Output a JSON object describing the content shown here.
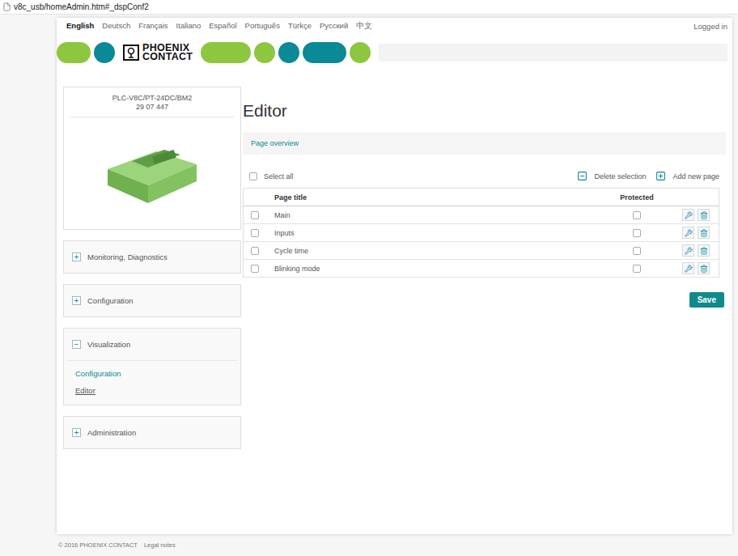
{
  "browser": {
    "address": "v8c_usb/homeAdmin.htm#_dspConf2"
  },
  "languages": [
    {
      "label": "English",
      "selected": true
    },
    {
      "label": "Deutsch",
      "selected": false
    },
    {
      "label": "Français",
      "selected": false
    },
    {
      "label": "Italiano",
      "selected": false
    },
    {
      "label": "Español",
      "selected": false
    },
    {
      "label": "Português",
      "selected": false
    },
    {
      "label": "Türkçe",
      "selected": false
    },
    {
      "label": "Русский",
      "selected": false
    },
    {
      "label": "中文",
      "selected": false
    }
  ],
  "login": "Logged in",
  "logo": {
    "line1": "PHOENIX",
    "line2": "CONTACT"
  },
  "device": {
    "name": "PLC-V8C/PT-24DC/BM2",
    "number": "29 07 447"
  },
  "sidebar": {
    "items": [
      {
        "label": "Monitoring, Diagnostics",
        "toggle": "+",
        "expanded": false,
        "links": []
      },
      {
        "label": "Configuration",
        "toggle": "+",
        "expanded": false,
        "links": []
      },
      {
        "label": "Visualization",
        "toggle": "−",
        "expanded": true,
        "links": [
          {
            "label": "Configuration",
            "selected": false
          },
          {
            "label": "Editor",
            "selected": true
          }
        ]
      },
      {
        "label": "Administration",
        "toggle": "+",
        "expanded": false,
        "links": []
      }
    ]
  },
  "editor": {
    "title": "Editor",
    "breadcrumb": "Page overview",
    "select_all": {
      "label": "Select all",
      "checked": false
    },
    "delete": "Delete selection",
    "add": "Add new page",
    "columns": [
      "Page title",
      "Protected"
    ],
    "rows": [
      {
        "title": "Main",
        "checked": false,
        "protected": false
      },
      {
        "title": "Inputs",
        "checked": false,
        "protected": false
      },
      {
        "title": "Cycle time",
        "checked": false,
        "protected": false
      },
      {
        "title": "Blinking mode",
        "checked": false,
        "protected": false
      }
    ],
    "save": "Save"
  },
  "footer": {
    "copyright": "© 2016 PHOENIX CONTACT",
    "legal": "Legal notes"
  }
}
